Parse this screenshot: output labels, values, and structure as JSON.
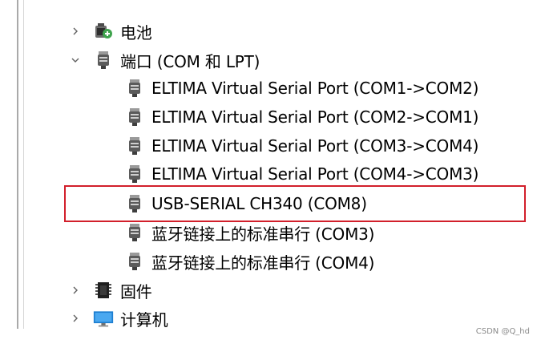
{
  "tree": {
    "battery": {
      "label": "电池",
      "icon": "battery-icon",
      "expanded": false
    },
    "ports": {
      "label": "端口 (COM 和 LPT)",
      "icon": "port-icon",
      "expanded": true,
      "children": [
        {
          "label": "ELTIMA Virtual Serial Port (COM1->COM2)"
        },
        {
          "label": "ELTIMA Virtual Serial Port (COM2->COM1)"
        },
        {
          "label": "ELTIMA Virtual Serial Port (COM3->COM4)"
        },
        {
          "label": "ELTIMA Virtual Serial Port (COM4->COM3)"
        },
        {
          "label": "USB-SERIAL CH340 (COM8)",
          "highlighted": true
        },
        {
          "label": "蓝牙链接上的标准串行 (COM3)"
        },
        {
          "label": "蓝牙链接上的标准串行 (COM4)"
        }
      ]
    },
    "firmware": {
      "label": "固件",
      "icon": "firmware-chip-icon",
      "expanded": false
    },
    "computer": {
      "label": "计算机",
      "icon": "monitor-icon",
      "expanded": false
    }
  },
  "highlight_color": "#d21f2b",
  "watermark": "CSDN @Q_hd"
}
